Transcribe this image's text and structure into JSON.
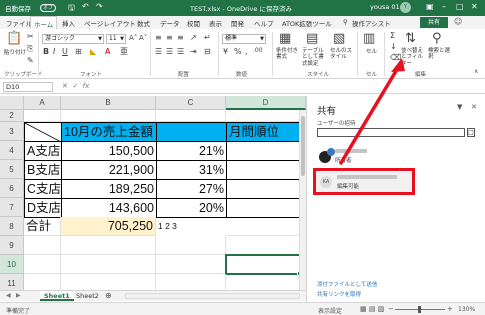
{
  "titlebar": {
    "autosave_label": "自動保存",
    "autosave_state": "オフ",
    "document_title": "TEST.xlsx  -  OneDrive に保存済み",
    "user_name": "yousa 01",
    "user_initials": "Y",
    "quick_access": [
      "save-icon",
      "undo-icon",
      "redo-icon"
    ]
  },
  "tabs": [
    "ファイル",
    "ホーム",
    "挿入",
    "ページレイアウト",
    "数式",
    "データ",
    "校閲",
    "表示",
    "開発",
    "ヘルプ",
    "ATOK拡張ツール",
    "操作アシスト"
  ],
  "active_tab": "ホーム",
  "share_button": "共有",
  "ribbon": {
    "paste_label": "貼り付け",
    "font_name": "游ゴシック",
    "font_size": "11",
    "number_format": "標準",
    "styles": [
      "条件付き書式",
      "テーブルとして書式設定",
      "セルのスタイル"
    ],
    "cells_label": "セル",
    "editing": [
      "並べ替えとフィルター",
      "検索と選択"
    ],
    "groups": [
      "クリップボード",
      "フォント",
      "配置",
      "数値",
      "スタイル",
      "セル",
      "編集"
    ]
  },
  "formula_bar": {
    "name_box": "D10",
    "value": ""
  },
  "columns": [
    "A",
    "B",
    "C",
    "D"
  ],
  "rows": [
    "2",
    "3",
    "4",
    "5",
    "6",
    "7",
    "8",
    "9",
    "10",
    "11"
  ],
  "cells": {
    "header_b": "10月の売上金額",
    "header_d": "月間順位",
    "branches": [
      "A支店",
      "B支店",
      "C支店",
      "D支店"
    ],
    "sales": [
      "150,500",
      "221,900",
      "189,250",
      "143,600"
    ],
    "ratios": [
      "21%",
      "31%",
      "27%",
      "20%"
    ],
    "total_label": "合計",
    "total_value": "705,250",
    "flag_text": "1 2 3"
  },
  "sheet_tabs": [
    "Sheet1",
    "Sheet2"
  ],
  "active_sheet": "Sheet1",
  "status": {
    "ready": "準備完了",
    "display_settings": "表示設定",
    "zoom": "130%"
  },
  "share_pane": {
    "title": "共有",
    "invite_label": "ユーザーの招待",
    "owner_role": "所有者",
    "editor_initials": "KA",
    "editor_role": "編集可能",
    "link_send_attachment": "添付ファイルとして送信",
    "link_get_share": "共有リンクを取得"
  },
  "accent_colors": {
    "excel_green": "#217346",
    "header_fill": "#00b0f0",
    "total_fill": "#fff2cc",
    "highlight_red": "#e8101f"
  }
}
